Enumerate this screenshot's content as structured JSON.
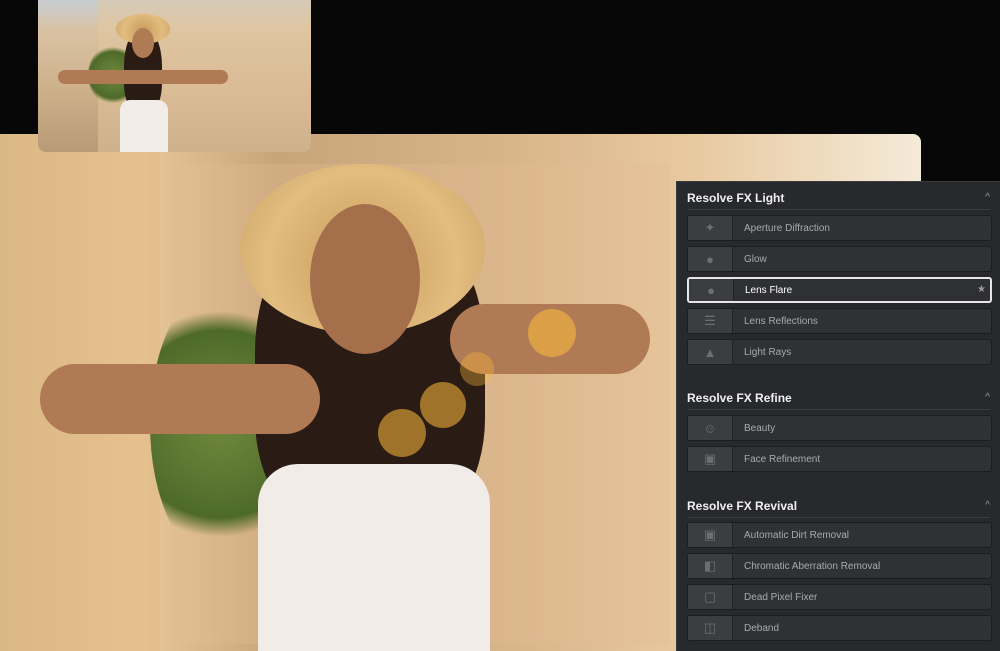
{
  "thumbnail": {
    "alt": "source clip preview"
  },
  "viewer": {
    "alt": "graded clip with lens flare"
  },
  "panel": {
    "sections": [
      {
        "title": "Resolve FX Light",
        "items": [
          {
            "label": "Aperture Diffraction",
            "icon": "sparkle-icon"
          },
          {
            "label": "Glow",
            "icon": "glow-icon"
          },
          {
            "label": "Lens Flare",
            "icon": "lens-flare-icon",
            "selected": true,
            "favorite": true
          },
          {
            "label": "Lens Reflections",
            "icon": "reflections-icon"
          },
          {
            "label": "Light Rays",
            "icon": "rays-icon"
          }
        ]
      },
      {
        "title": "Resolve FX Refine",
        "items": [
          {
            "label": "Beauty",
            "icon": "face-icon"
          },
          {
            "label": "Face Refinement",
            "icon": "face-frame-icon"
          }
        ]
      },
      {
        "title": "Resolve FX Revival",
        "items": [
          {
            "label": "Automatic Dirt Removal",
            "icon": "image-frame-icon"
          },
          {
            "label": "Chromatic Aberration Removal",
            "icon": "split-frame-icon"
          },
          {
            "label": "Dead Pixel Fixer",
            "icon": "pixel-icon"
          },
          {
            "label": "Deband",
            "icon": "deband-icon"
          }
        ]
      }
    ],
    "collapse_glyph": "^",
    "star_glyph": "★"
  }
}
